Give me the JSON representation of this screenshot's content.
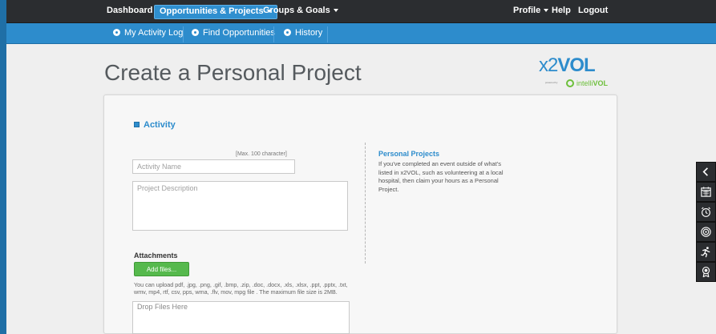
{
  "topnav": {
    "dashboard": "Dashboard",
    "opportunities": "Opportunities & Projects",
    "groups": "Groups & Goals",
    "profile": "Profile",
    "help": "Help",
    "logout": "Logout"
  },
  "subnav": {
    "activity_log": "My Activity Log",
    "find_opportunities": "Find Opportunities",
    "history": "History"
  },
  "page": {
    "title": "Create a Personal Project"
  },
  "logo": {
    "x2": "x2",
    "vol": "VOL",
    "powered": "powered by",
    "intelli": "intelli",
    "intelli_vol": "VOL"
  },
  "form": {
    "section_title": "Activity",
    "max_chars": "[Max. 100 character]",
    "activity_name_placeholder": "Activity Name",
    "project_description_placeholder": "Project Description",
    "attachments_title": "Attachments",
    "add_files_label": "Add files...",
    "upload_note": "You can upload pdf, .jpg, .png, .gif, .bmp, .zip, .doc, .docx, .xls, .xlsx, .ppt, .pptx, .txt, wmv, mp4, rtf, csv, pps, wma, .flv, mov, mpg file . The maximum file size is 2MB.",
    "drop_files": "Drop Files Here"
  },
  "info": {
    "title": "Personal Projects",
    "text": "If you've completed an event outside of what's listed in x2VOL, such as volunteering at a local hospital, then claim your hours as a Personal Project."
  },
  "rightbar": {
    "icons": [
      "chevron-left-icon",
      "calendar-icon",
      "alarm-clock-icon",
      "target-icon",
      "runner-icon",
      "award-icon"
    ]
  },
  "colors": {
    "accent": "#2d8ccc",
    "nav_dark": "#2b2d30",
    "button_green": "#56b94d"
  }
}
